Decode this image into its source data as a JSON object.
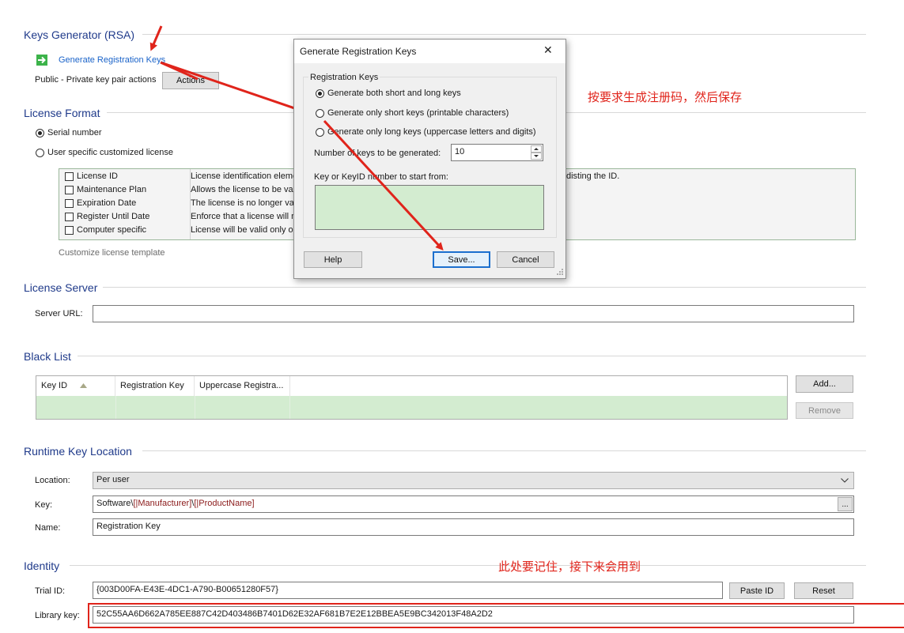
{
  "keys_generator": {
    "title": "Keys Generator (RSA)",
    "generate_link": "Generate Registration Keys",
    "keypair_label": "Public - Private key pair actions",
    "actions_button": "Actions"
  },
  "license_format": {
    "title": "License Format",
    "options": [
      "Serial number",
      "User specific customized license"
    ],
    "selected": "Serial number",
    "rows": [
      {
        "name": "License ID",
        "desc": "License identification eleme"
      },
      {
        "name": "Maintenance Plan",
        "desc": "Allows the license to be vali"
      },
      {
        "name": "Expiration Date",
        "desc": "The license is no longer vali"
      },
      {
        "name": "Register Until Date",
        "desc": "Enforce that a license will n"
      },
      {
        "name": "Computer specific",
        "desc": "License will be valid only on"
      }
    ],
    "right_fragment": "disting the ID.",
    "customize_link": "Customize license template"
  },
  "license_server": {
    "title": "License Server",
    "server_url_label": "Server URL:",
    "server_url_value": ""
  },
  "black_list": {
    "title": "Black List",
    "columns": [
      "Key ID",
      "Registration Key",
      "Uppercase Registra..."
    ],
    "add_button": "Add...",
    "remove_button": "Remove"
  },
  "runtime_key_location": {
    "title": "Runtime Key Location",
    "location_label": "Location:",
    "location_value": "Per user",
    "key_label": "Key:",
    "key_prefix": "Software\\",
    "key_manufacturer": "[|Manufacturer]",
    "key_sep": "\\",
    "key_product": "[|ProductName]",
    "key_browse": "...",
    "name_label": "Name:",
    "name_value": "Registration Key"
  },
  "identity": {
    "title": "Identity",
    "trial_id_label": "Trial ID:",
    "trial_id_value": "{003D00FA-E43E-4DC1-A790-B00651280F57}",
    "paste_id_button": "Paste ID",
    "reset_button": "Reset",
    "library_key_label": "Library key:",
    "library_key_value": "52C55AA6D662A785EE887C42D403486B7401D62E32AF681B7E2E12BBEA5E9BC342013F48A2D2"
  },
  "annotations": {
    "note_generate": "按要求生成注册码，然后保存",
    "note_remember": "此处要记住，接下来会用到"
  },
  "dialog": {
    "title": "Generate Registration Keys",
    "close_glyph": "✕",
    "group_label": "Registration Keys",
    "options": [
      "Generate both short and long keys",
      "Generate only short keys (printable characters)",
      "Generate only long keys (uppercase letters and digits)"
    ],
    "selected": "Generate both short and long keys",
    "count_label": "Number of keys to be generated:",
    "count_value": "10",
    "start_label": "Key or KeyID number to start from:",
    "help_button": "Help",
    "save_button": "Save...",
    "cancel_button": "Cancel"
  },
  "colors": {
    "section_title": "#1f3a8a",
    "annotation_red": "#e0241b",
    "highlight_green": "#d3ecd0",
    "link_blue": "#1a63c9"
  }
}
